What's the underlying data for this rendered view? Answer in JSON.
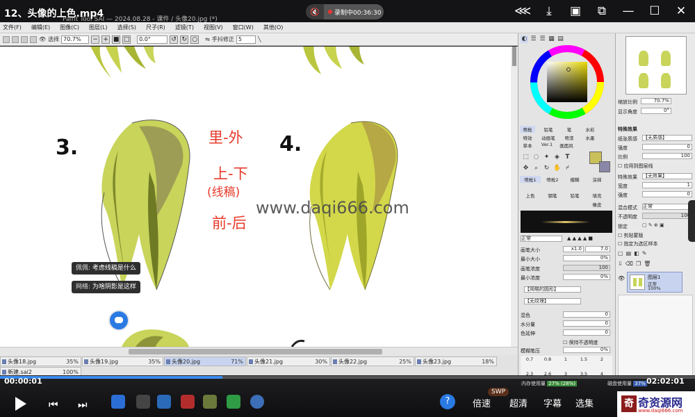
{
  "player": {
    "title": "12、头像的上色.mp4",
    "sai_title_partial": "Paint Tool SAI — 2024.08.28 - 课件 / 头像20.jpg (*)",
    "recording_label": "录制中00:36:30",
    "icons": [
      "share-icon",
      "download-icon",
      "screenshot-icon",
      "pip-icon",
      "minimize-icon",
      "maximize-icon",
      "close-icon"
    ],
    "current_time": "00:00:01",
    "total_time": "02:02:01",
    "progress": 0.32,
    "options": [
      "倍速",
      "超清",
      "字幕",
      "选集"
    ],
    "swp_badge": "SWP"
  },
  "menu": [
    "文件(F)",
    "编辑(E)",
    "图像(C)",
    "图层(L)",
    "选择(S)",
    "尺子(R)",
    "滤镜(T)",
    "视图(V)",
    "窗口(W)",
    "其他(O)"
  ],
  "toolbar": {
    "select_label": "选择",
    "zoom": "70.7%",
    "rotation": "0.0°",
    "stabilizer_label": "手抖修正",
    "stabilizer": "5"
  },
  "canvas": {
    "step3": "3.",
    "step4": "4.",
    "notes": [
      "里-外",
      "上-下",
      "(线稿)",
      "前-后"
    ],
    "watermark": "www.daqi666.com",
    "chat": [
      {
        "user": "佩佩:",
        "text": "考虑线稿是什么"
      },
      {
        "user": "网络:",
        "text": "为啥阴影是这样"
      }
    ]
  },
  "tabs": [
    {
      "name": "头像18.jpg",
      "pct": "35%"
    },
    {
      "name": "头像19.jpg",
      "pct": "35%"
    },
    {
      "name": "头像20.jpg",
      "pct": "71%",
      "active": true
    },
    {
      "name": "头像21.jpg",
      "pct": "30%"
    },
    {
      "name": "头像22.jpg",
      "pct": "25%"
    },
    {
      "name": "头像23.jpg",
      "pct": "18%"
    },
    {
      "name": "新建.sai2",
      "pct": "100%"
    }
  ],
  "brush_panel": {
    "tab_row1": [
      "喷枪",
      "铅笔",
      "笔",
      "水彩"
    ],
    "tab_row2": [
      "特效",
      "动画笔",
      "喷漆",
      "水墨"
    ],
    "tab_row3": [
      "草本",
      "Ver.1",
      "画面风"
    ],
    "brush_tools": [
      "喷枪1",
      "喷枪2",
      "模糊",
      "涂抹",
      "上色",
      "钢笔",
      "抠",
      "铅笔",
      "填充",
      "橡皮"
    ],
    "mode": "正常",
    "brush_size_label": "画笔大小",
    "brush_size_mult": "x1.0",
    "brush_size": "7.0",
    "min_size_label": "最小大小",
    "min_size": "0%",
    "density_label": "画笔浓度",
    "density": "100",
    "min_density_label": "最小浓度",
    "min_density": "0%",
    "edge_label": "【简略的圆形】",
    "texture_label": "【无纹理】",
    "blend_label": "混色",
    "blend": "0",
    "water_label": "水分量",
    "water": "0",
    "stretch_label": "色延伸",
    "stretch": "0",
    "keep_opacity": "保持不透明度",
    "blur_label": "模糊笔压",
    "blur": "0%",
    "size_presets_top": [
      "0.7",
      "0.8",
      "1",
      "1.5",
      "2"
    ],
    "size_presets_bottom": [
      "2.3",
      "2.6",
      "3",
      "3.5",
      "4"
    ],
    "memory_label": "内存使用量",
    "memory": "27% (28%)"
  },
  "layer_panel": {
    "zoom_label": "缩放比例",
    "zoom": "70.7%",
    "angle_label": "显示角度",
    "angle": "0°",
    "effect_header": "特殊效果",
    "paper_label": "纸张质感",
    "paper": "【无质感】",
    "strength_label": "强度",
    "strength": "0",
    "scale_label": "比例",
    "scale": "100",
    "apply_label": "应用到图层线",
    "fx_label": "特殊效果",
    "fx": "【无效果】",
    "width_label": "宽度",
    "width": "1",
    "strength2_label": "强度",
    "strength2": "0",
    "blend_mode_label": "混合模式",
    "blend_mode": "正常",
    "opacity_label": "不透明度",
    "opacity": "100",
    "lock_label": "锁定",
    "clip_label": "剪贴蒙版",
    "ref_label": "指定为选区样本",
    "layer_name": "图层1",
    "layer_mode": "正常",
    "layer_opacity": "100%",
    "disk_label": "磁盘使用量",
    "disk": "37%"
  },
  "brand": {
    "name": "奇资源网",
    "url": "www.daqi666.com",
    "seal": "奇"
  },
  "colors": {
    "accent": "#3b8cf0",
    "hair_light": "#c9d45a",
    "hair_dark": "#8b8f3a",
    "note_red": "#e63a2a",
    "fg_color": "#c9c05a",
    "bg_color": "#8a87a8"
  }
}
